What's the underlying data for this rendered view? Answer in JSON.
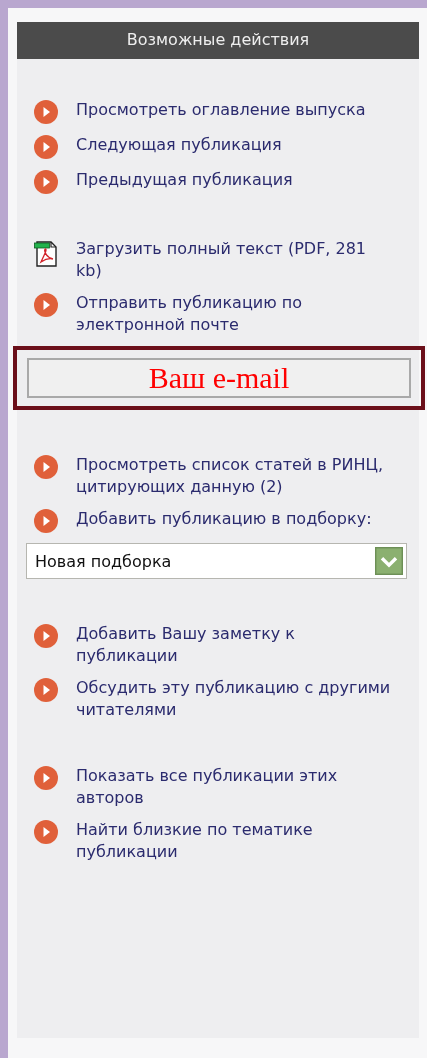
{
  "header": {
    "title": "Возможные действия"
  },
  "groups": [
    {
      "items": [
        {
          "kind": "link",
          "text": "Просмотреть оглавление выпуска"
        },
        {
          "kind": "link",
          "text": "Следующая публикация"
        },
        {
          "kind": "link",
          "text": "Предыдущая публикация"
        }
      ]
    },
    {
      "items": [
        {
          "kind": "pdf",
          "text": "Загрузить полный текст (PDF, 281 kb)"
        },
        {
          "kind": "link",
          "text": "Отправить публикацию по электронной почте"
        },
        {
          "kind": "email",
          "placeholder": "Ваш e-mail"
        }
      ]
    },
    {
      "items": [
        {
          "kind": "link",
          "text": "Просмотреть список статей в РИНЦ, цитирующих данную (2)"
        },
        {
          "kind": "link",
          "text": "Добавить публикацию в подборку:"
        },
        {
          "kind": "select",
          "value": "Новая подборка"
        }
      ]
    },
    {
      "items": [
        {
          "kind": "link",
          "text": "Добавить Вашу заметку к публикации"
        },
        {
          "kind": "link",
          "text": "Обсудить эту публикацию с другими читателями"
        }
      ]
    },
    {
      "items": [
        {
          "kind": "link",
          "text": "Показать все публикации этих авторов"
        },
        {
          "kind": "link",
          "text": "Найти близкие по тематике публикации"
        }
      ]
    }
  ]
}
